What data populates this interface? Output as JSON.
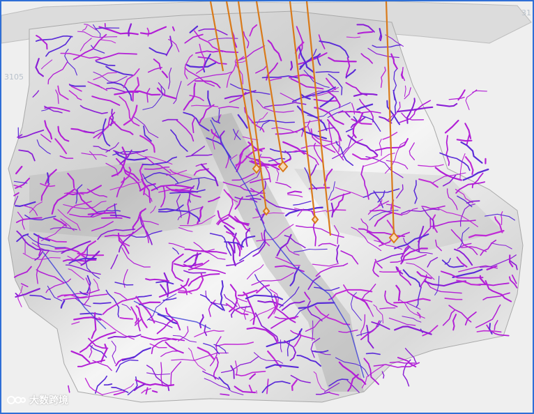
{
  "viewer": {
    "axis_label_left": "3105",
    "axis_label_right": "31",
    "watermark_text": "大数跨境"
  },
  "colors": {
    "frame_border": "#2f6fd6",
    "background": "#efefef",
    "fracture_lines": "#b21fd6",
    "fracture_lines_alt": "#5a2bd8",
    "well_paths": "#d97a1a",
    "surface_light": "#f2f2f2",
    "surface_shadow": "#9a9a9a"
  },
  "icons": {
    "well_marker": "diamond-marker-icon",
    "watermark_logo": "logo-icon"
  }
}
